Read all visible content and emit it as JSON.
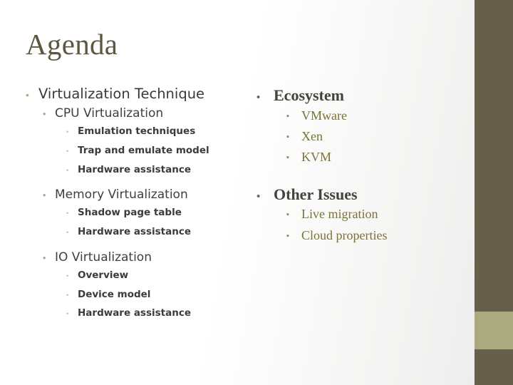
{
  "slide": {
    "title": "Agenda",
    "colors": {
      "title_text": "#5d5742",
      "edge_bar": "#665f4a",
      "edge_accent": "#aaaa80",
      "level1_bullet": "#b0ae7e",
      "level2_bullet": "#9aa8a6",
      "level3_bullet": "#c5c49b",
      "right_level1_text": "#44423a",
      "right_level2_text": "#7a7436",
      "right_bullet": "#8a8750"
    },
    "bullet_glyphs": {
      "dot_square": "▪",
      "dot_round": "•",
      "small_square": "▪"
    }
  },
  "left_column": {
    "items": [
      {
        "level": 1,
        "bullet": "•",
        "text": "Virtualization Technique"
      },
      {
        "level": 2,
        "bullet": "•",
        "text": "CPU Virtualization"
      },
      {
        "level": 3,
        "bullet": "•",
        "text": "Emulation techniques"
      },
      {
        "level": 3,
        "bullet": "•",
        "text": "Trap and emulate model"
      },
      {
        "level": 3,
        "bullet": "•",
        "text": "Hardware assistance"
      },
      {
        "level": 2,
        "bullet": "•",
        "text": "Memory Virtualization"
      },
      {
        "level": 3,
        "bullet": "•",
        "text": "Shadow page table"
      },
      {
        "level": 3,
        "bullet": "•",
        "text": "Hardware assistance"
      },
      {
        "level": 2,
        "bullet": "•",
        "text": "IO Virtualization"
      },
      {
        "level": 3,
        "bullet": "•",
        "text": "Overview"
      },
      {
        "level": 3,
        "bullet": "•",
        "text": "Device model"
      },
      {
        "level": 3,
        "bullet": "•",
        "text": "Hardware assistance"
      }
    ]
  },
  "right_column": {
    "groups": [
      {
        "heading": {
          "bullet": "•",
          "text": "Ecosystem"
        },
        "items": [
          {
            "bullet": "▪",
            "text": "VMware"
          },
          {
            "bullet": "▪",
            "text": "Xen"
          },
          {
            "bullet": "▪",
            "text": "KVM"
          }
        ]
      },
      {
        "heading": {
          "bullet": "•",
          "text": "Other Issues"
        },
        "items": [
          {
            "bullet": "▪",
            "text": "Live migration"
          },
          {
            "bullet": "▪",
            "text": "Cloud properties"
          }
        ]
      }
    ]
  }
}
